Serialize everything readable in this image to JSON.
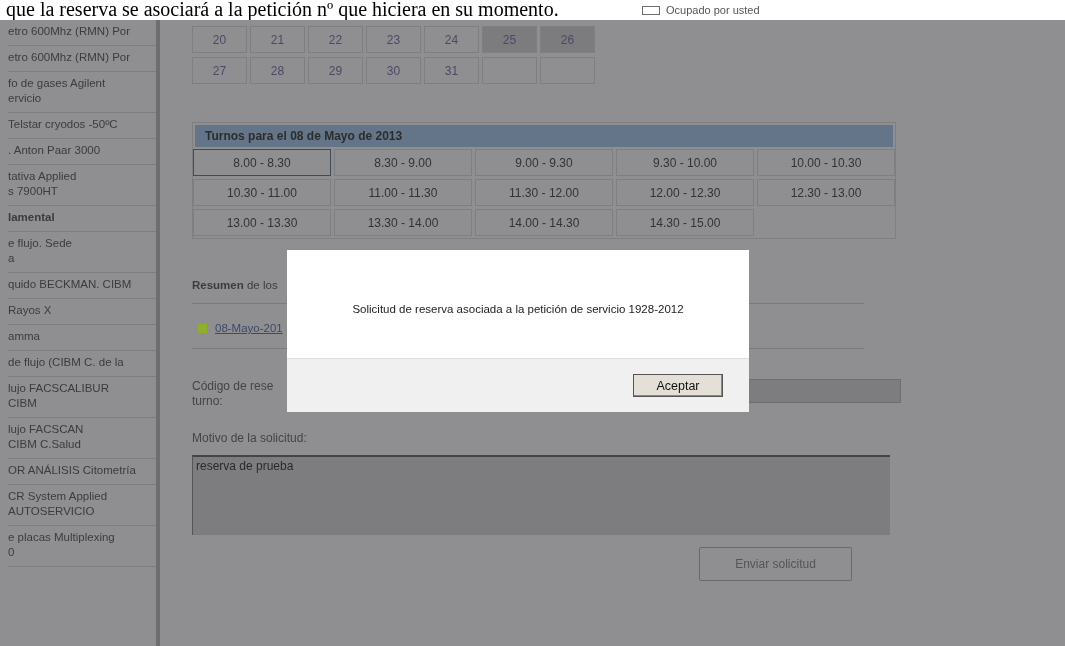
{
  "page_heading": "que la reserva se asociará a la petición nº que hiciera en su momento.",
  "sidebar": {
    "items": [
      {
        "kind": "item",
        "text": "etro 600Mhz (RMN) Por"
      },
      {
        "kind": "item",
        "text": "etro 600Mhz (RMN) Por"
      },
      {
        "kind": "item",
        "text": "fo de gases Agilent\nervicio"
      },
      {
        "kind": "item",
        "text": "Telstar cryodos -50ºC"
      },
      {
        "kind": "item",
        "text": ". Anton Paar 3000"
      },
      {
        "kind": "item",
        "text": "tativa Applied\ns 7900HT"
      },
      {
        "kind": "category",
        "text": "lamental"
      },
      {
        "kind": "item",
        "text": "e flujo. Sede\na"
      },
      {
        "kind": "item",
        "text": "quido BECKMAN. CIBM"
      },
      {
        "kind": "item",
        "text": "Rayos X"
      },
      {
        "kind": "item",
        "text": "amma"
      },
      {
        "kind": "item",
        "text": "de flujo (CIBM C. de la"
      },
      {
        "kind": "item",
        "text": "lujo FACSCALIBUR\nCIBM"
      },
      {
        "kind": "item",
        "text": "lujo FACSCAN\nCIBM C.Salud"
      },
      {
        "kind": "item",
        "text": "OR ANÁLISIS Citometría"
      },
      {
        "kind": "item",
        "text": "CR System Applied\nAUTOSERVICIO"
      },
      {
        "kind": "item",
        "text": "e placas Multiplexing\n0"
      }
    ]
  },
  "calendar": {
    "legend": "Ocupado por usted",
    "weeks": [
      [
        {
          "kind": "day",
          "day": "20",
          "occupied": false
        },
        {
          "kind": "day",
          "day": "21",
          "occupied": false
        },
        {
          "kind": "day",
          "day": "22",
          "occupied": false
        },
        {
          "kind": "day",
          "day": "23",
          "occupied": false
        },
        {
          "kind": "day",
          "day": "24",
          "occupied": false
        },
        {
          "kind": "day",
          "day": "25",
          "occupied": true
        },
        {
          "kind": "day",
          "day": "26",
          "occupied": true
        }
      ],
      [
        {
          "kind": "day",
          "day": "27",
          "occupied": false
        },
        {
          "kind": "day",
          "day": "28",
          "occupied": false
        },
        {
          "kind": "day",
          "day": "29",
          "occupied": false
        },
        {
          "kind": "day",
          "day": "30",
          "occupied": false
        },
        {
          "kind": "day",
          "day": "31",
          "occupied": false
        },
        {
          "kind": "blank"
        },
        {
          "kind": "blank"
        }
      ]
    ]
  },
  "turnos": {
    "title": "Turnos para el 08 de Mayo de 2013",
    "slots": [
      {
        "label": "8.00 - 8.30",
        "selected": true
      },
      {
        "label": "8.30 - 9.00",
        "selected": false
      },
      {
        "label": "9.00 - 9.30",
        "selected": false
      },
      {
        "label": "9.30 - 10.00",
        "selected": false
      },
      {
        "label": "10.00 - 10.30",
        "selected": false
      },
      {
        "label": "10.30 - 11.00",
        "selected": false
      },
      {
        "label": "11.00 - 11.30",
        "selected": false
      },
      {
        "label": "11.30 - 12.00",
        "selected": false
      },
      {
        "label": "12.00 - 12.30",
        "selected": false
      },
      {
        "label": "12.30 - 13.00",
        "selected": false
      },
      {
        "label": "13.00 - 13.30",
        "selected": false
      },
      {
        "label": "13.30 - 14.00",
        "selected": false
      },
      {
        "label": "14.00 - 14.30",
        "selected": false
      },
      {
        "label": "14.30 - 15.00",
        "selected": false
      }
    ]
  },
  "summary": {
    "heading": "**Resumen** de los",
    "entries": [
      {
        "link": "08-Mayo-201",
        "color": "#8fae2a"
      }
    ]
  },
  "form": {
    "code_label": "Código de rese\nturno:",
    "motivo_label": "Motivo de la solicitud:",
    "motivo_value": "reserva de prueba",
    "submit": "Enviar solicitud"
  },
  "dialog": {
    "message": "Solicitud de reserva asociada a la petición de servicio 1928-2012",
    "button": "Aceptar"
  }
}
